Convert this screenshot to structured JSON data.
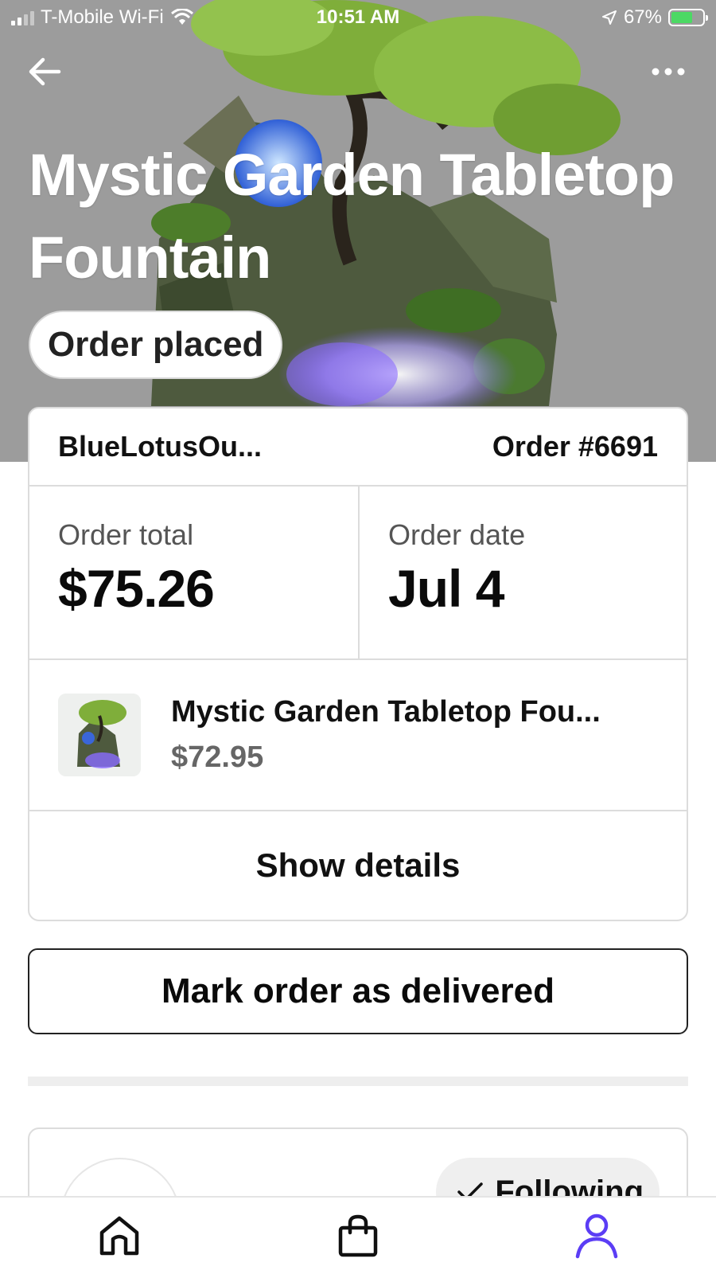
{
  "status_bar": {
    "carrier": "T-Mobile Wi-Fi",
    "time": "10:51 AM",
    "battery": "67%"
  },
  "header": {
    "title": "Mystic Garden Tabletop Fountain",
    "status": "Order placed"
  },
  "order": {
    "shop_name": "BlueLotusOu...",
    "order_number": "Order #6691",
    "total_label": "Order total",
    "total_value": "$75.26",
    "date_label": "Order date",
    "date_value": "Jul 4",
    "item": {
      "name": "Mystic Garden Tabletop Fou...",
      "price": "$72.95"
    },
    "show_details": "Show details"
  },
  "actions": {
    "mark_delivered": "Mark order as delivered"
  },
  "shop_card": {
    "follow_label": "Following"
  },
  "nav": {
    "items": [
      "home-icon",
      "bag-icon",
      "profile-icon"
    ],
    "active": "profile-icon",
    "active_color": "#5b3df5"
  }
}
